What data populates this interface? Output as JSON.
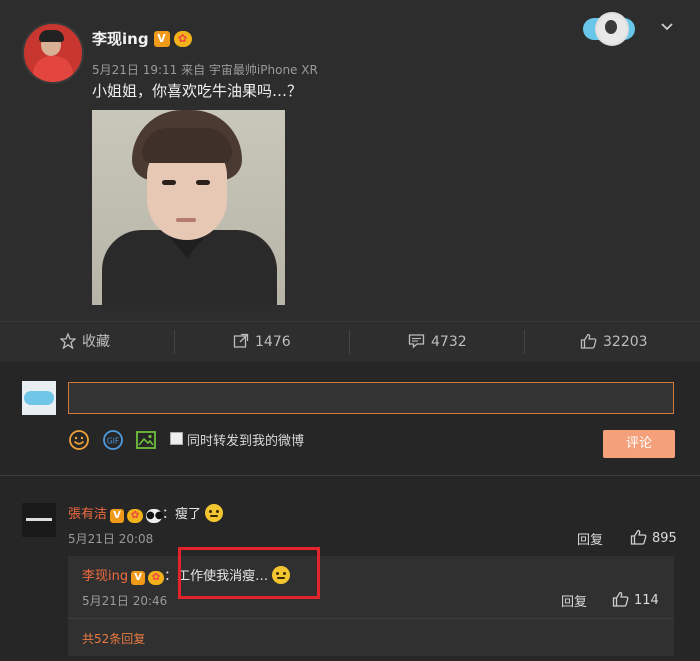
{
  "post": {
    "author": "李现ing",
    "verified_badge": "V",
    "meta": "5月21日 19:11 来自 宇宙最帅iPhone XR",
    "text": "小姐姐，你喜欢吃牛油果吗…？"
  },
  "actions": {
    "favorite": "收藏",
    "repost_count": "1476",
    "comment_count": "4732",
    "like_count": "32203"
  },
  "composer": {
    "forward_label": "同时转发到我的微博",
    "submit_label": "评论",
    "gif_label": "GIF"
  },
  "comments": [
    {
      "author": "張有洁",
      "verified_badge": "V",
      "text": "：瘦了",
      "time": "5月21日 20:08",
      "reply_label": "回复",
      "like_count": "895",
      "replies": [
        {
          "author": "李现ing",
          "verified_badge": "V",
          "text": "：工作使我消瘦…",
          "time": "5月21日 20:46",
          "reply_label": "回复",
          "like_count": "114"
        }
      ],
      "more_replies": "共52条回复"
    }
  ],
  "colors": {
    "username_orange": "#f06a3f",
    "badge_orange": "#f09a1a",
    "submit_bg": "#f3a07b",
    "highlight_red": "#e3252b",
    "background": "#2b2b2b"
  }
}
